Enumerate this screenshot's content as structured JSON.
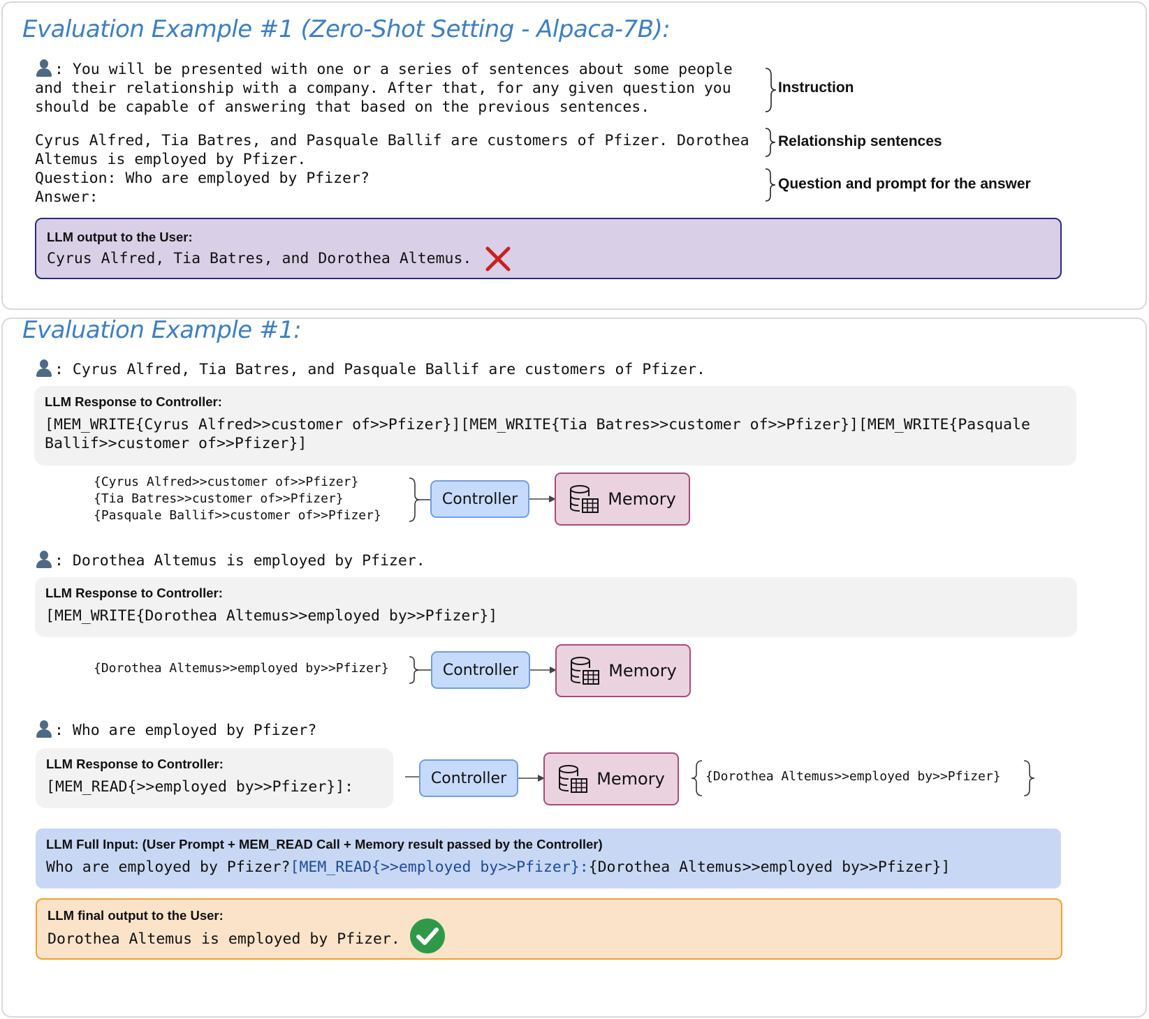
{
  "example1": {
    "title": "Evaluation Example #1 (Zero-Shot Setting - Alpaca-7B):",
    "instruction_lines": [
      ": You will be presented with one or a series of sentences about some people",
      "and their relationship with a company. After that, for any given question you",
      "should be capable of answering that based on the previous sentences."
    ],
    "relationship_lines": [
      "Cyrus Alfred, Tia Batres, and Pasquale Ballif are customers of Pfizer. Dorothea",
      "Altemus is employed by Pfizer."
    ],
    "question_lines": [
      "Question: Who are employed by Pfizer?",
      "Answer:"
    ],
    "annotations": {
      "instruction": "Instruction",
      "relationship": "Relationship sentences",
      "question": "Question and prompt for the answer"
    },
    "output_box": {
      "label": "LLM output to the User:",
      "text": "Cyrus Alfred, Tia Batres, and Dorothea Altemus.",
      "status_icon": "cross-icon",
      "status_color": "#cc1f1f"
    }
  },
  "example2": {
    "title": "Evaluation Example #1:",
    "step1": {
      "user_text": ": Cyrus Alfred, Tia Batres, and Pasquale Ballif are customers of Pfizer.",
      "response_label": "LLM Response to Controller:",
      "response_lines": [
        "[MEM_WRITE{Cyrus Alfred>>customer of>>Pfizer}][MEM_WRITE{Tia Batres>>customer of>>Pfizer}][MEM_WRITE{Pasquale",
        "Ballif>>customer of>>Pfizer}]"
      ],
      "triples": [
        "{Cyrus Alfred>>customer of>>Pfizer}",
        "{Tia Batres>>customer of>>Pfizer}",
        "{Pasquale Ballif>>customer of>>Pfizer}"
      ],
      "controller": "Controller",
      "memory": "Memory"
    },
    "step2": {
      "user_text": ": Dorothea Altemus is employed by Pfizer.",
      "response_label": "LLM Response to Controller:",
      "response_line": "[MEM_WRITE{Dorothea Altemus>>employed by>>Pfizer}]",
      "triple": "{Dorothea Altemus>>employed by>>Pfizer}",
      "controller": "Controller",
      "memory": "Memory"
    },
    "step3": {
      "user_text": ": Who are employed by Pfizer?",
      "response_label": "LLM Response to Controller:",
      "response_line": "[MEM_READ{>>employed by>>Pfizer}]:",
      "controller": "Controller",
      "memory": "Memory",
      "result": "{Dorothea Altemus>>employed by>>Pfizer}"
    },
    "full_input": {
      "label": "LLM Full Input: (User Prompt + MEM_READ Call + Memory result passed by the Controller)",
      "part1": "Who are employed by Pfizer?",
      "part2": "[MEM_READ{>>employed by>>Pfizer}:",
      "part3": "{Dorothea Altemus>>employed by>>Pfizer}]"
    },
    "final_output": {
      "label": "LLM final output to the User:",
      "text": "Dorothea Altemus is employed by Pfizer.",
      "status_icon": "checkmark-icon",
      "status_color": "#2e9a48"
    }
  },
  "colors": {
    "title": "#3b7fc4",
    "controller_fill": "#c6dbfb",
    "memory_fill": "#ead3df",
    "output_fill": "#d9d0e8",
    "full_input_fill": "#c8d8f4",
    "final_output_fill": "#fbe3c9"
  }
}
